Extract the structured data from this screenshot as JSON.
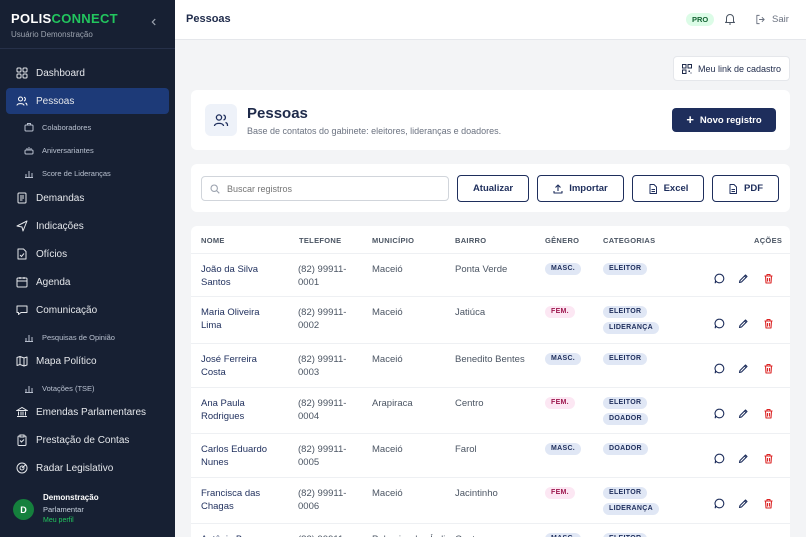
{
  "app": {
    "brand_part1": "POLIS",
    "brand_part2": "CONNECT",
    "subtitle": "Usuário Demonstração"
  },
  "colors": {
    "sidebar_bg": "#172033",
    "accent_green": "#22c55e",
    "primary": "#1e2e5c"
  },
  "sidebar": {
    "items": [
      {
        "label": "Dashboard",
        "icon": "grid-icon"
      },
      {
        "label": "Pessoas",
        "icon": "users-icon"
      },
      {
        "label": "Colaboradores",
        "icon": "briefcase-icon"
      },
      {
        "label": "Aniversariantes",
        "icon": "cake-icon"
      },
      {
        "label": "Score de Lideranças",
        "icon": "bar-chart-icon"
      },
      {
        "label": "Demandas",
        "icon": "document-icon"
      },
      {
        "label": "Indicações",
        "icon": "send-icon"
      },
      {
        "label": "Ofícios",
        "icon": "file-icon"
      },
      {
        "label": "Agenda",
        "icon": "calendar-icon"
      },
      {
        "label": "Comunicação",
        "icon": "chat-icon"
      },
      {
        "label": "Pesquisas de Opinião",
        "icon": "bar-chart-icon"
      },
      {
        "label": "Mapa Político",
        "icon": "map-icon"
      },
      {
        "label": "Votações (TSE)",
        "icon": "bar-chart-icon"
      },
      {
        "label": "Emendas Parlamentares",
        "icon": "bank-icon"
      },
      {
        "label": "Prestação de Contas",
        "icon": "clipboard-icon"
      },
      {
        "label": "Radar Legislativo",
        "icon": "radar-icon"
      }
    ],
    "user": {
      "initial": "D",
      "name": "Demonstração",
      "role": "Parlamentar",
      "link": "Meu perfil"
    }
  },
  "topbar": {
    "title": "Pessoas",
    "plan_badge": "PRO",
    "logout_label": "Sair"
  },
  "link_button": "Meu link de cadastro",
  "header": {
    "title": "Pessoas",
    "subtitle": "Base de contatos do gabinete: eleitores, lideranças e doadores.",
    "new_button": "Novo registro"
  },
  "toolbar": {
    "search_placeholder": "Buscar registros",
    "refresh": "Atualizar",
    "import": "Importar",
    "excel": "Excel",
    "pdf": "PDF"
  },
  "table": {
    "headers": {
      "name": "NOME",
      "phone": "TELEFONE",
      "city": "MUNICÍPIO",
      "district": "BAIRRO",
      "gender": "GÊNERO",
      "categories": "CATEGORIAS",
      "actions": "AÇÕES"
    },
    "rows": [
      {
        "name1": "João da Silva",
        "name2": "Santos",
        "phone1": "(82) 99911-",
        "phone2": "0001",
        "city": "Maceió",
        "district": "Ponta Verde",
        "gender": "MASC.",
        "cat1": "ELEITOR",
        "cat2": ""
      },
      {
        "name1": "Maria Oliveira",
        "name2": "Lima",
        "phone1": "(82) 99911-",
        "phone2": "0002",
        "city": "Maceió",
        "district": "Jatiúca",
        "gender": "FEM.",
        "cat1": "ELEITOR",
        "cat2": "LIDERANÇA"
      },
      {
        "name1": "José Ferreira",
        "name2": "Costa",
        "phone1": "(82) 99911-",
        "phone2": "0003",
        "city": "Maceió",
        "district": "Benedito Bentes",
        "gender": "MASC.",
        "cat1": "ELEITOR",
        "cat2": ""
      },
      {
        "name1": "Ana Paula",
        "name2": "Rodrigues",
        "phone1": "(82) 99911-",
        "phone2": "0004",
        "city": "Arapiraca",
        "district": "Centro",
        "gender": "FEM.",
        "cat1": "ELEITOR",
        "cat2": "DOADOR"
      },
      {
        "name1": "Carlos Eduardo",
        "name2": "Nunes",
        "phone1": "(82) 99911-",
        "phone2": "0005",
        "city": "Maceió",
        "district": "Farol",
        "gender": "MASC.",
        "cat1": "DOADOR",
        "cat2": ""
      },
      {
        "name1": "Francisca das",
        "name2": "Chagas",
        "phone1": "(82) 99911-",
        "phone2": "0006",
        "city": "Maceió",
        "district": "Jacintinho",
        "gender": "FEM.",
        "cat1": "ELEITOR",
        "cat2": "LIDERANÇA"
      },
      {
        "name1": "Antônio Bezerra",
        "name2": "",
        "phone1": "(82) 99911-",
        "phone2": "",
        "city": "Palmeira dos Índios",
        "district": "Centro",
        "gender": "MASC.",
        "cat1": "ELEITOR",
        "cat2": ""
      }
    ]
  }
}
